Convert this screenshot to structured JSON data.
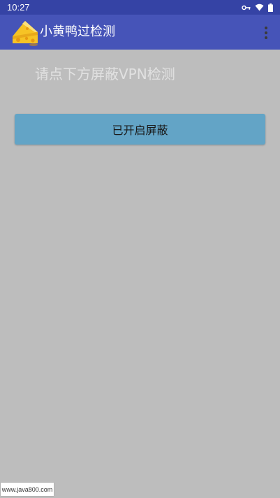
{
  "status_bar": {
    "time": "10:27",
    "icons": [
      "vpn-key-icon",
      "wifi-icon",
      "battery-icon"
    ]
  },
  "app_bar": {
    "title": "小黄鸭过检测",
    "logo_icon": "cheese-icon",
    "menu_icon": "overflow-menu-icon"
  },
  "main": {
    "hint": "请点下方屏蔽VPN检测",
    "shield_button_label": "已开启屏蔽"
  },
  "watermark": {
    "text": "www.java800.com"
  },
  "colors": {
    "status_bar": "#3543a5",
    "app_bar": "#4654b8",
    "background": "#bdbdbd",
    "button": "#63a4c6"
  }
}
